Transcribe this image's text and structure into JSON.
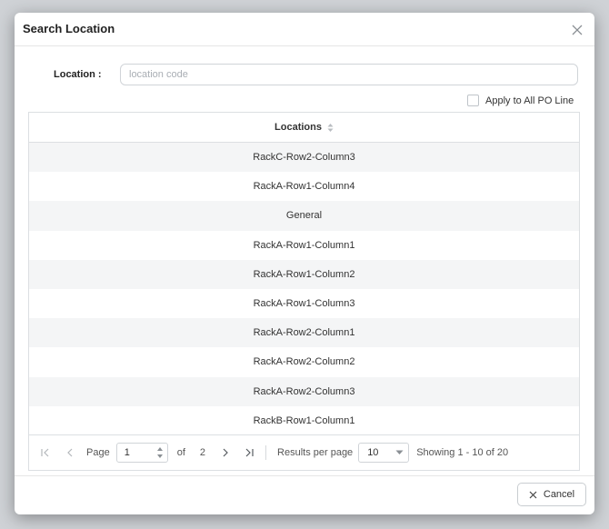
{
  "dialog": {
    "title": "Search Location"
  },
  "form": {
    "location_label": "Location :",
    "location_value": "",
    "location_placeholder": "location code",
    "apply_all_label": "Apply to All PO Line",
    "apply_all_checked": false
  },
  "grid": {
    "column_header": "Locations",
    "rows": [
      "RackC-Row2-Column3",
      "RackA-Row1-Column4",
      "General",
      "RackA-Row1-Column1",
      "RackA-Row1-Column2",
      "RackA-Row1-Column3",
      "RackA-Row2-Column1",
      "RackA-Row2-Column2",
      "RackA-Row2-Column3",
      "RackB-Row1-Column1"
    ]
  },
  "pager": {
    "page_label": "Page",
    "current_page": "1",
    "of_label": "of",
    "total_pages": "2",
    "results_per_page_label": "Results per page",
    "results_per_page": "10",
    "showing_text": "Showing 1 - 10 of 20"
  },
  "footer": {
    "cancel_label": "Cancel"
  },
  "colors": {
    "row_alt": "#f4f5f6",
    "border": "#dcdfe2",
    "placeholder": "#a9aeb4"
  }
}
